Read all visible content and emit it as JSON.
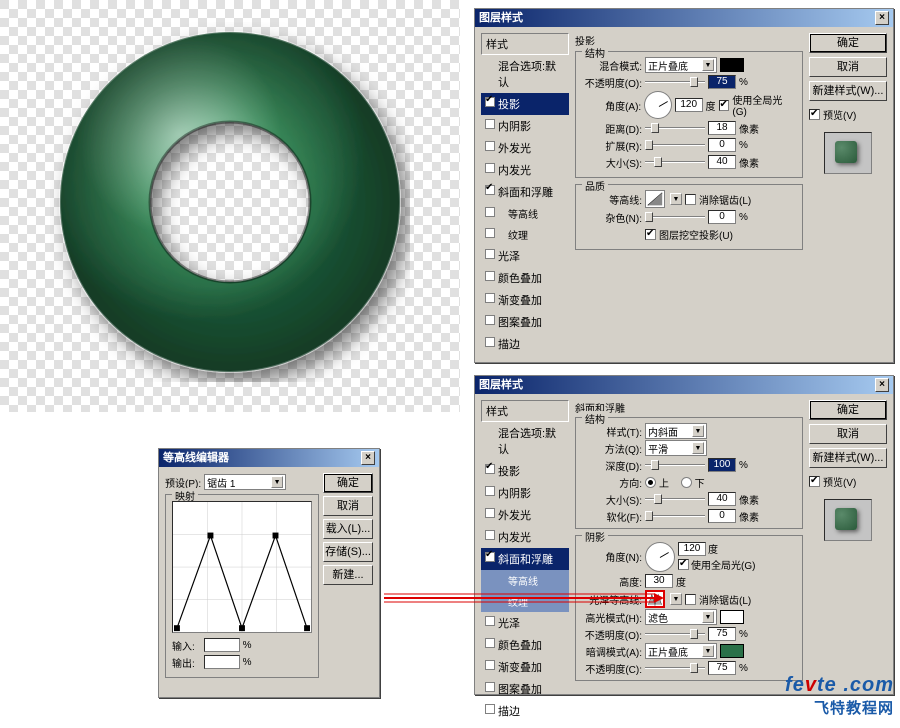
{
  "dialogs": {
    "top_title": "图层样式",
    "bottom_title": "图层样式",
    "contour_title": "等高线编辑器"
  },
  "buttons": {
    "ok": "确定",
    "cancel": "取消",
    "new_style": "新建样式(W)...",
    "preview": "预览(V)",
    "load": "载入(L)...",
    "save": "存储(S)...",
    "new": "新建..."
  },
  "style_list": {
    "header": "样式",
    "blend_options": "混合选项:默认",
    "drop_shadow": "投影",
    "inner_shadow": "内阴影",
    "outer_glow": "外发光",
    "inner_glow": "内发光",
    "bevel_emboss": "斜面和浮雕",
    "contour": "等高线",
    "texture": "纹理",
    "satin": "光泽",
    "color_overlay": "颜色叠加",
    "gradient_overlay": "渐变叠加",
    "pattern_overlay": "图案叠加",
    "stroke": "描边"
  },
  "drop_shadow_panel": {
    "title": "投影",
    "structure": "结构",
    "blend_mode": "混合模式:",
    "blend_mode_val": "正片叠底",
    "opacity": "不透明度(O):",
    "opacity_val": "75",
    "angle": "角度(A):",
    "angle_val": "120",
    "angle_unit": "度",
    "use_global": "使用全局光(G)",
    "distance": "距离(D):",
    "distance_val": "18",
    "px": "像素",
    "spread": "扩展(R):",
    "spread_val": "0",
    "size": "大小(S):",
    "size_val": "40",
    "quality": "品质",
    "contour": "等高线:",
    "anti_alias": "消除锯齿(L)",
    "noise": "杂色(N):",
    "noise_val": "0",
    "knockout": "图层挖空投影(U)",
    "pct": "%"
  },
  "bevel_panel": {
    "title": "斜面和浮雕",
    "structure": "结构",
    "style": "样式(T):",
    "style_val": "内斜面",
    "technique": "方法(Q):",
    "technique_val": "平滑",
    "depth": "深度(D):",
    "depth_val": "100",
    "direction": "方向:",
    "up": "上",
    "down": "下",
    "size": "大小(S):",
    "size_val": "40",
    "soften": "软化(F):",
    "soften_val": "0",
    "shading": "阴影",
    "angle": "角度(N):",
    "angle_val": "120",
    "angle_unit": "度",
    "use_global": "使用全局光(G)",
    "altitude": "高度:",
    "altitude_val": "30",
    "gloss_contour": "光泽等高线:",
    "anti_alias": "消除锯齿(L)",
    "highlight_mode": "高光模式(H):",
    "highlight_mode_val": "滤色",
    "h_opacity": "不透明度(O):",
    "h_opacity_val": "75",
    "shadow_mode": "暗调模式(A):",
    "shadow_mode_val": "正片叠底",
    "s_opacity": "不透明度(C):",
    "s_opacity_val": "75",
    "px": "像素",
    "pct": "%"
  },
  "contour_editor": {
    "preset": "预设(P):",
    "preset_val": "锯齿 1",
    "mapping": "映射",
    "input": "输入:",
    "output": "输出:",
    "pct": "%"
  },
  "watermark": {
    "main": "fevte .com",
    "sub": "飞特教程网"
  }
}
